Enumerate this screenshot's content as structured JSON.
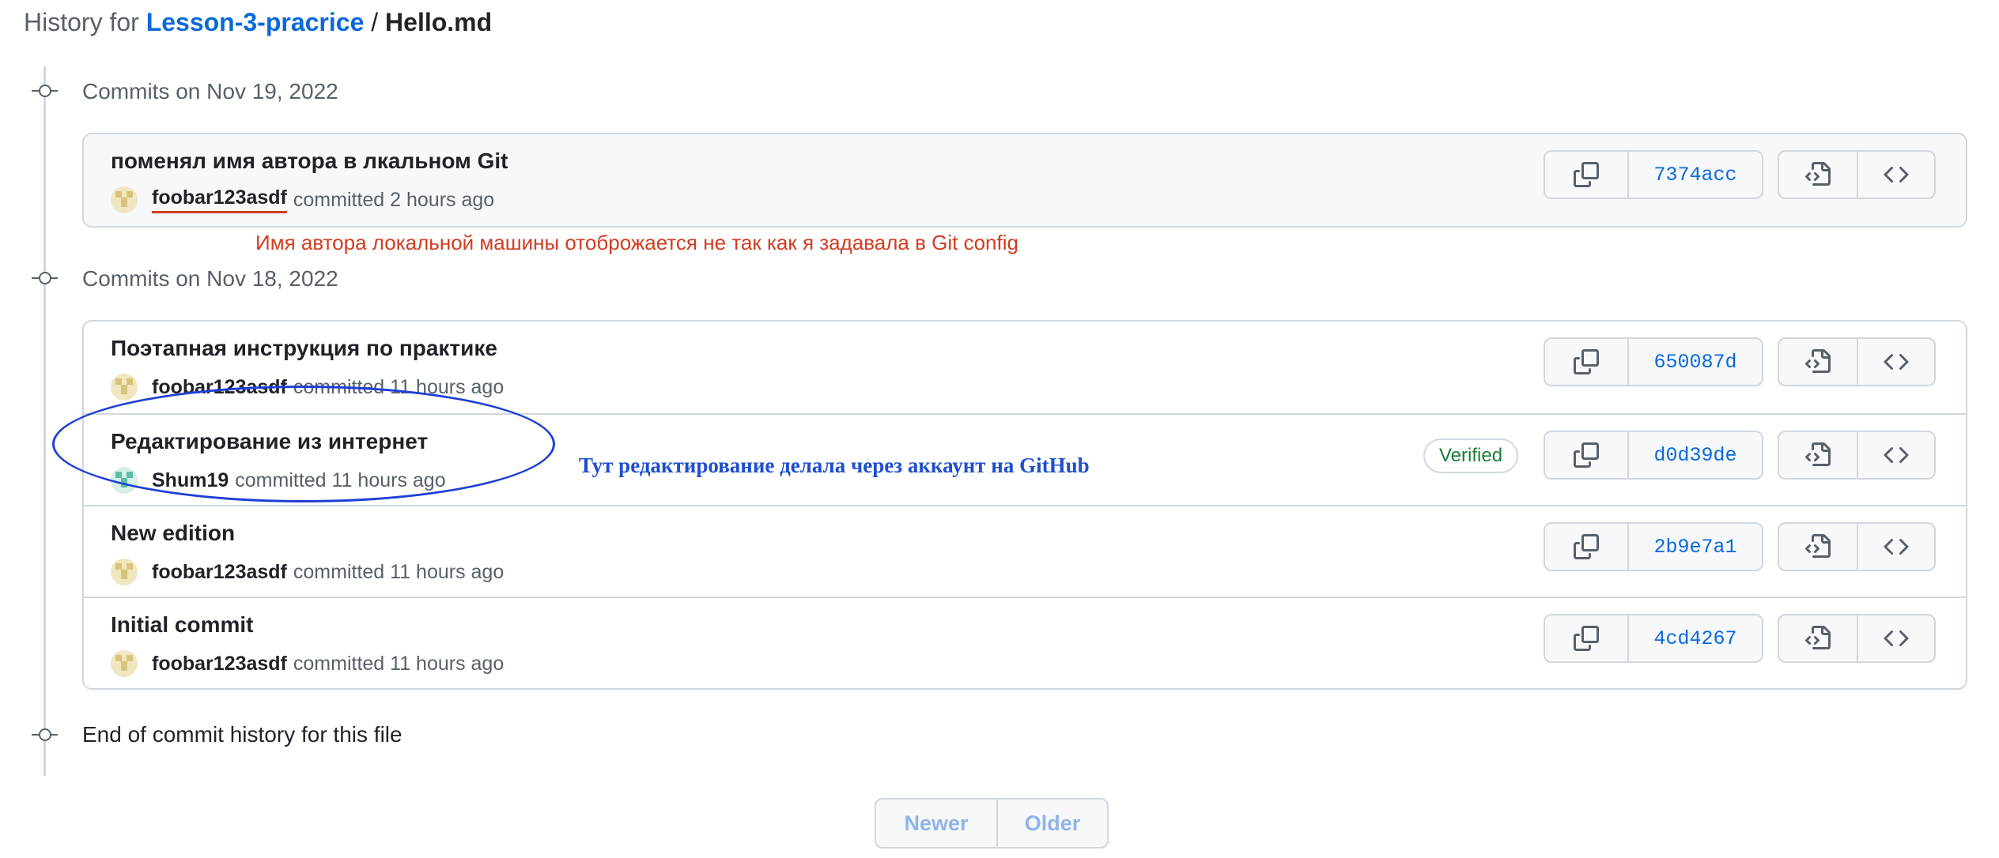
{
  "header": {
    "prefix": "History for",
    "repo": "Lesson-3-pracrice",
    "separator": "/",
    "file": "Hello.md"
  },
  "groups": [
    {
      "label": "Commits on Nov 19, 2022",
      "commits": [
        {
          "title": "поменял имя автора в лкальном Git",
          "author": "foobar123asdf",
          "committed": "committed 2 hours ago",
          "sha": "7374acc",
          "verified": ""
        }
      ]
    },
    {
      "label": "Commits on Nov 18, 2022",
      "commits": [
        {
          "title": "Поэтапная инструкция по практике",
          "author": "foobar123asdf",
          "committed": "committed 11 hours ago",
          "sha": "650087d",
          "verified": ""
        },
        {
          "title": "Редактирование из интернет",
          "author": "Shum19",
          "committed": "committed 11 hours ago",
          "sha": "d0d39de",
          "verified": "Verified"
        },
        {
          "title": "New edition",
          "author": "foobar123asdf",
          "committed": "committed 11 hours ago",
          "sha": "2b9e7a1",
          "verified": ""
        },
        {
          "title": "Initial commit",
          "author": "foobar123asdf",
          "committed": "committed 11 hours ago",
          "sha": "4cd4267",
          "verified": ""
        }
      ]
    }
  ],
  "end_label": "End of commit history for this file",
  "annotations": {
    "red_note": "Имя автора локальной машины отоброжается не так как я задавала в Git config",
    "blue_note": "Тут редактирование  делала через аккаунт на  GitHub"
  },
  "pagination": {
    "newer": "Newer",
    "older": "Older"
  },
  "colors": {
    "link": "#0969da",
    "annotation_red": "#d23b1f",
    "annotation_blue": "#1f3fd6",
    "verified": "#1a7f37"
  }
}
